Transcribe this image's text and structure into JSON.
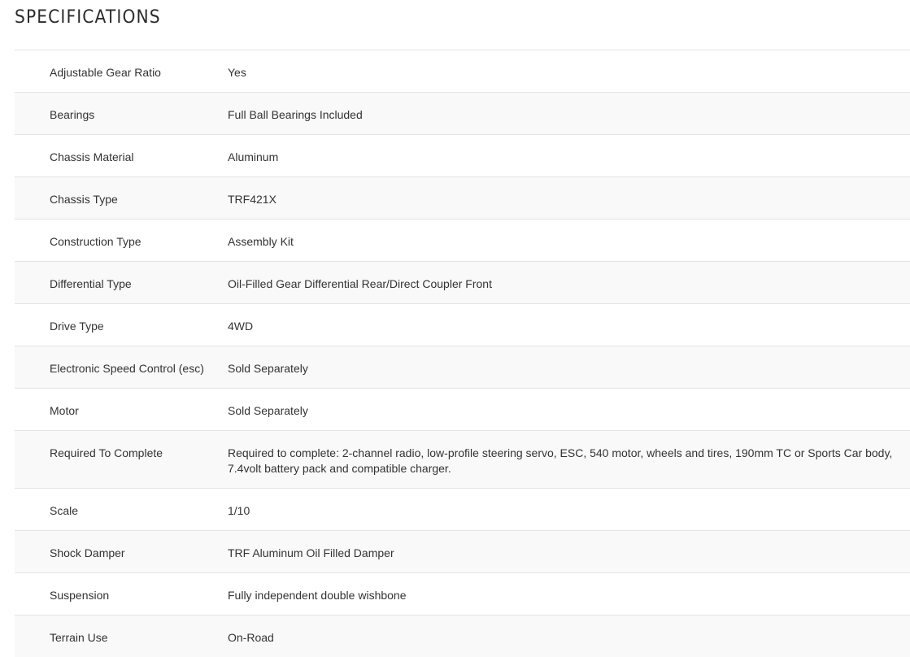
{
  "section": {
    "title": "SPECIFICATIONS"
  },
  "specs": [
    {
      "label": "Adjustable Gear Ratio",
      "value": "Yes"
    },
    {
      "label": "Bearings",
      "value": "Full Ball Bearings Included"
    },
    {
      "label": "Chassis Material",
      "value": "Aluminum"
    },
    {
      "label": "Chassis Type",
      "value": "TRF421X"
    },
    {
      "label": "Construction Type",
      "value": "Assembly Kit"
    },
    {
      "label": "Differential Type",
      "value": "Oil-Filled Gear Differential Rear/Direct Coupler Front"
    },
    {
      "label": "Drive Type",
      "value": "4WD"
    },
    {
      "label": "Electronic Speed Control (esc)",
      "value": "Sold Separately"
    },
    {
      "label": "Motor",
      "value": "Sold Separately"
    },
    {
      "label": "Required To Complete",
      "value": "Required to complete: 2-channel radio, low-profile steering servo, ESC, 540 motor, wheels and tires, 190mm TC or Sports Car body, 7.4volt battery pack and compatible charger."
    },
    {
      "label": "Scale",
      "value": "1/10"
    },
    {
      "label": "Shock Damper",
      "value": "TRF Aluminum Oil Filled Damper"
    },
    {
      "label": "Suspension",
      "value": "Fully independent double wishbone"
    },
    {
      "label": "Terrain Use",
      "value": "On-Road"
    }
  ]
}
